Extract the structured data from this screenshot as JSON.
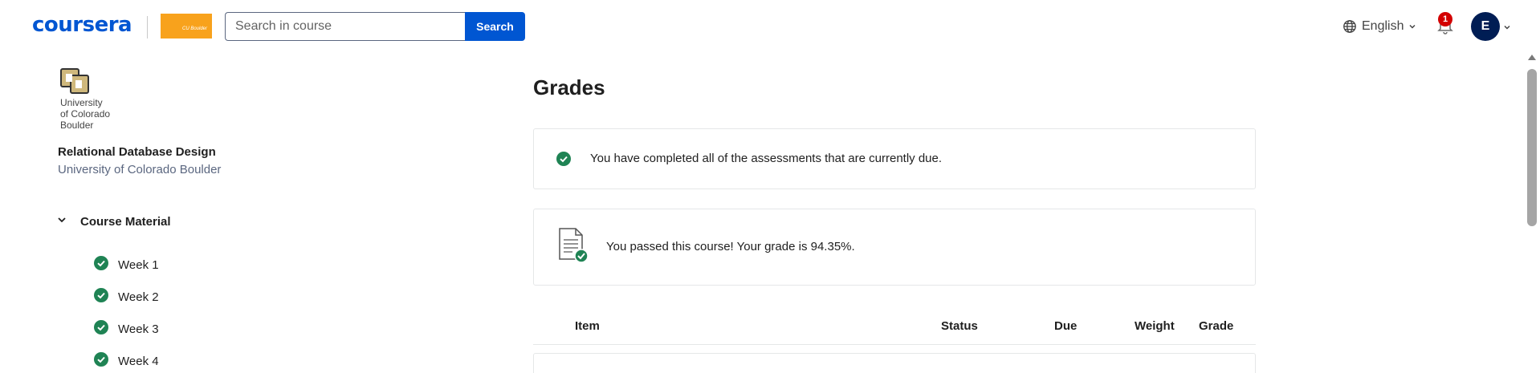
{
  "header": {
    "logo_text": "coursera",
    "partner_logo_text": "CU Boulder",
    "search": {
      "placeholder": "Search in course",
      "button_label": "Search"
    },
    "language": "English",
    "notification_count": "1",
    "avatar_initial": "E"
  },
  "sidebar": {
    "university_logo_text": "University of Colorado Boulder",
    "course_title": "Relational Database Design",
    "course_partner": "University of Colorado Boulder",
    "section": {
      "label": "Course Material",
      "expanded": true
    },
    "weeks": [
      {
        "label": "Week 1",
        "completed": true
      },
      {
        "label": "Week 2",
        "completed": true
      },
      {
        "label": "Week 3",
        "completed": true
      },
      {
        "label": "Week 4",
        "completed": true
      }
    ]
  },
  "main": {
    "title": "Grades",
    "status_message": "You have completed all of the assessments that are currently due.",
    "passed_message": "You passed this course! Your grade is 94.35%.",
    "table_headers": {
      "item": "Item",
      "status": "Status",
      "due": "Due",
      "weight": "Weight",
      "grade": "Grade"
    }
  },
  "colors": {
    "brand": "#0056d2",
    "success": "#1f8354",
    "avatar_bg": "#001d54",
    "badge": "#d30001",
    "partner_orange": "#f8a21c"
  }
}
